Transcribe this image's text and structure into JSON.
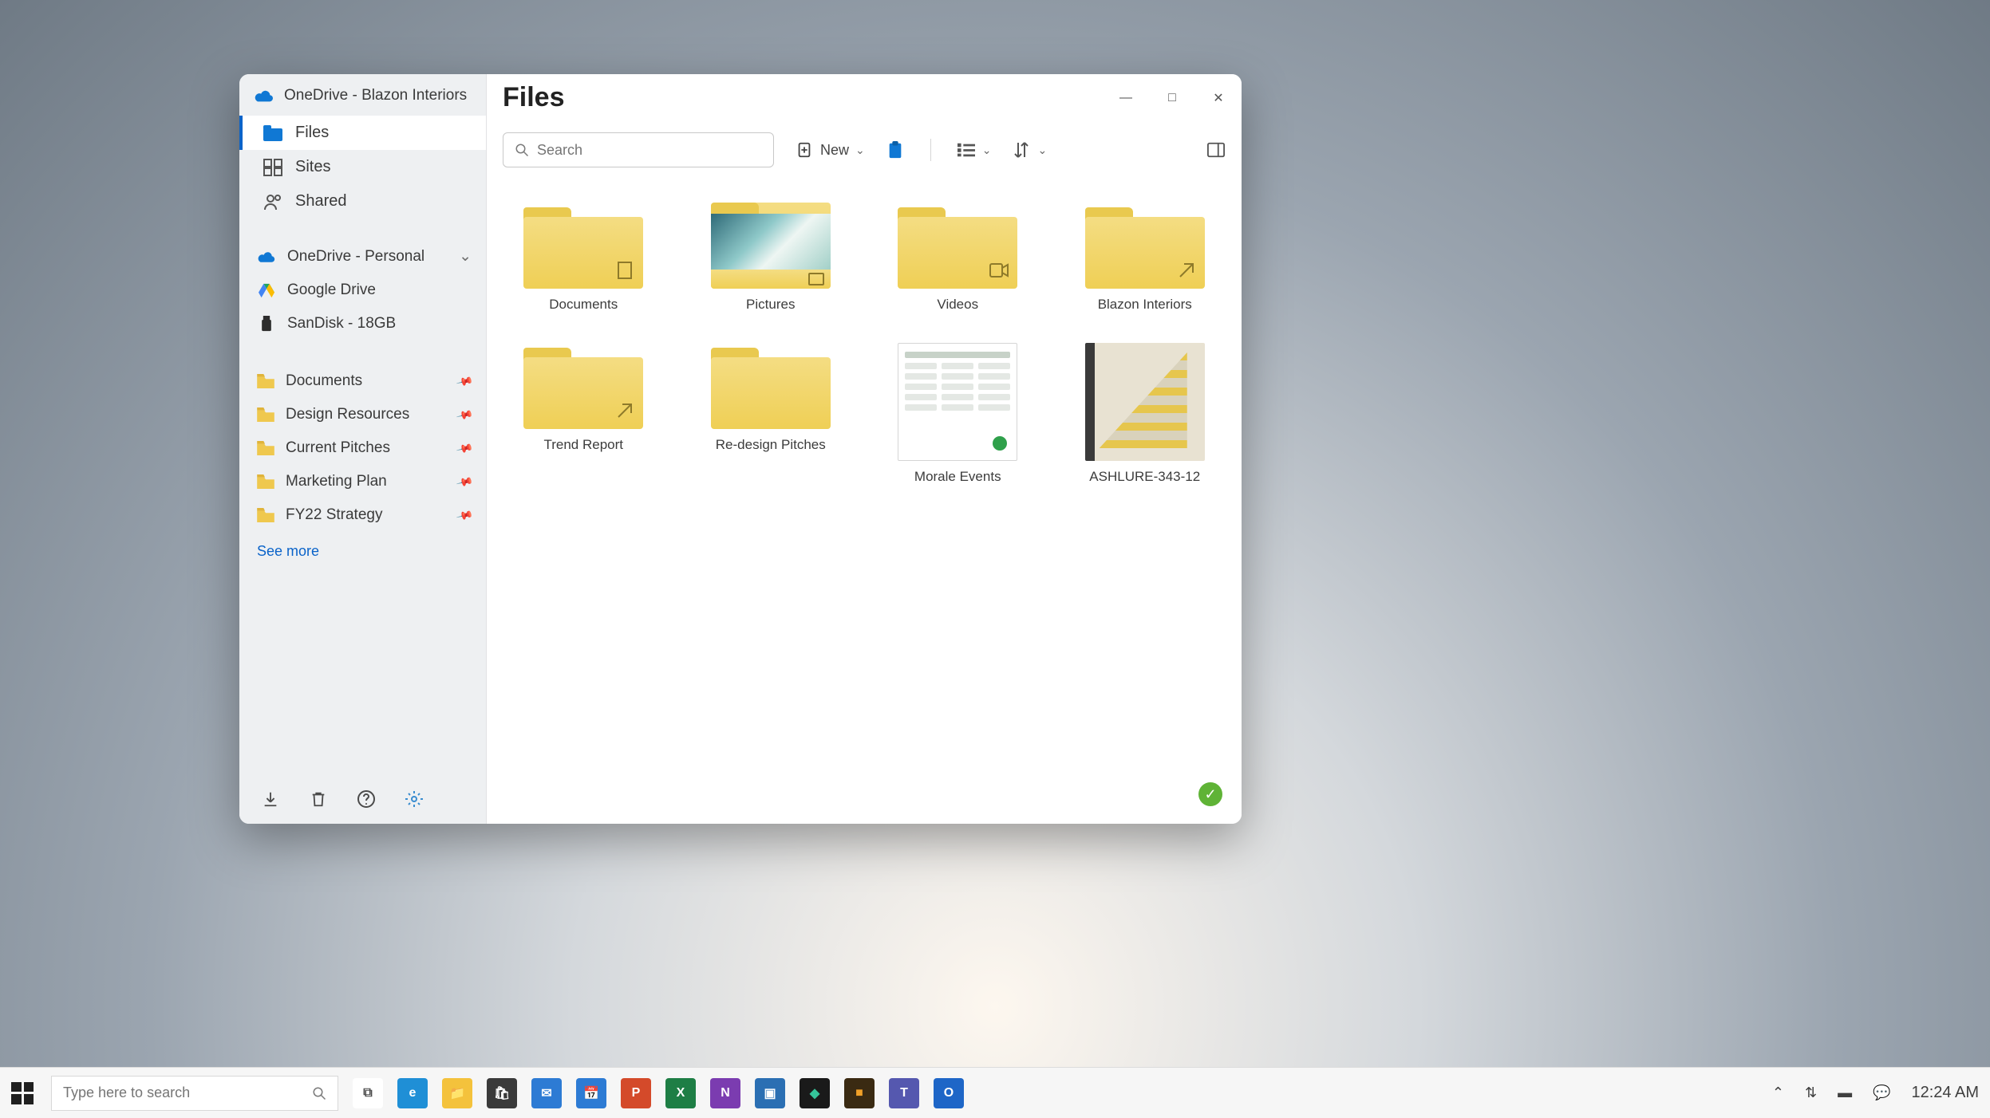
{
  "window": {
    "title": "Files",
    "account_title": "OneDrive - Blazon Interiors"
  },
  "sidebar": {
    "nav": [
      {
        "label": "Files"
      },
      {
        "label": "Sites"
      },
      {
        "label": "Shared"
      }
    ],
    "accounts": [
      {
        "label": "OneDrive - Personal"
      },
      {
        "label": "Google Drive"
      },
      {
        "label": "SanDisk - 18GB"
      }
    ],
    "pinned": [
      {
        "label": "Documents"
      },
      {
        "label": "Design Resources"
      },
      {
        "label": "Current Pitches"
      },
      {
        "label": "Marketing Plan"
      },
      {
        "label": "FY22 Strategy"
      }
    ],
    "see_more_label": "See more"
  },
  "toolbar": {
    "search_placeholder": "Search",
    "new_label": "New"
  },
  "files": [
    {
      "label": "Documents",
      "kind": "folder",
      "badge": "page"
    },
    {
      "label": "Pictures",
      "kind": "pictures"
    },
    {
      "label": "Videos",
      "kind": "folder",
      "badge": "video"
    },
    {
      "label": "Blazon Interiors",
      "kind": "folder",
      "badge": "link"
    },
    {
      "label": "Trend Report",
      "kind": "folder",
      "badge": "link"
    },
    {
      "label": "Re-design Pitches",
      "kind": "folder",
      "badge": ""
    },
    {
      "label": "Morale Events",
      "kind": "doc"
    },
    {
      "label": "ASHLURE-343-12",
      "kind": "image"
    }
  ],
  "taskbar": {
    "search_placeholder": "Type here to search",
    "apps": [
      {
        "name": "task-view",
        "bg": "#ffffff",
        "fg": "#4a4a4a",
        "glyph": "⧉"
      },
      {
        "name": "edge",
        "bg": "#1f8fd6",
        "fg": "#fff",
        "glyph": "e"
      },
      {
        "name": "file-explorer",
        "bg": "#f4c23c",
        "fg": "#8a6a12",
        "glyph": "📁"
      },
      {
        "name": "store",
        "bg": "#3a3a3a",
        "fg": "#fff",
        "glyph": "🛍"
      },
      {
        "name": "mail",
        "bg": "#2d7bd4",
        "fg": "#fff",
        "glyph": "✉"
      },
      {
        "name": "calendar",
        "bg": "#2d7bd4",
        "fg": "#fff",
        "glyph": "📅"
      },
      {
        "name": "powerpoint",
        "bg": "#d44a2a",
        "fg": "#fff",
        "glyph": "P"
      },
      {
        "name": "excel",
        "bg": "#1e7e45",
        "fg": "#fff",
        "glyph": "X"
      },
      {
        "name": "onenote",
        "bg": "#7b3cb0",
        "fg": "#fff",
        "glyph": "N"
      },
      {
        "name": "photos",
        "bg": "#2b6fb3",
        "fg": "#fff",
        "glyph": "▣"
      },
      {
        "name": "app-a",
        "bg": "#1a1a1a",
        "fg": "#35c49a",
        "glyph": "◆"
      },
      {
        "name": "app-b",
        "bg": "#3a2a12",
        "fg": "#f0a028",
        "glyph": "■"
      },
      {
        "name": "teams",
        "bg": "#5558af",
        "fg": "#fff",
        "glyph": "T"
      },
      {
        "name": "outlook",
        "bg": "#1e66c7",
        "fg": "#fff",
        "glyph": "O"
      }
    ],
    "clock": "12:24 AM"
  }
}
